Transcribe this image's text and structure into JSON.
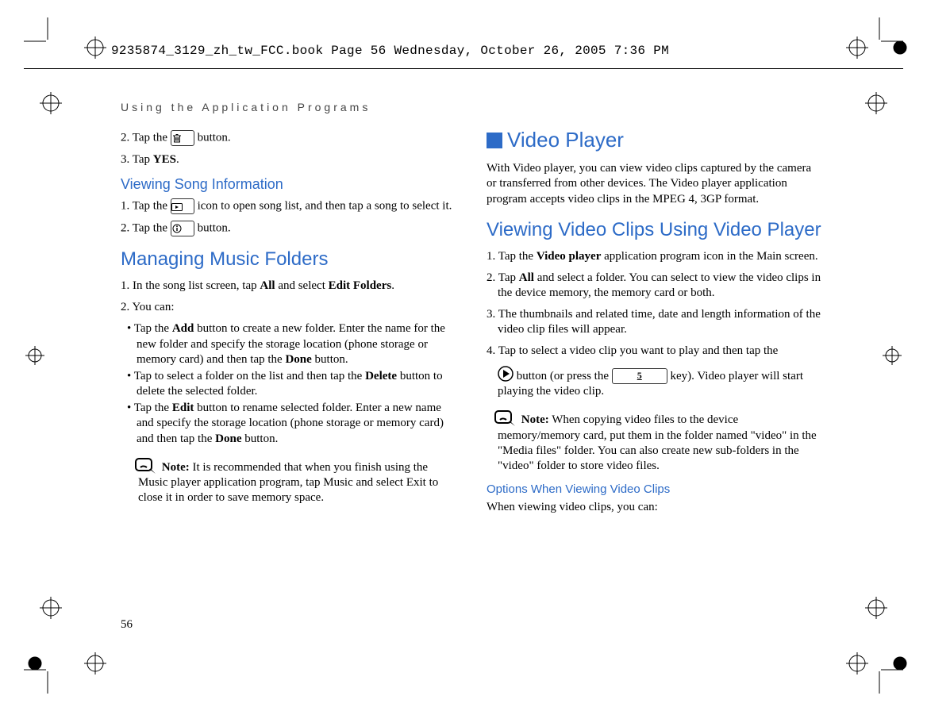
{
  "header": {
    "framemaker_line": "9235874_3129_zh_tw_FCC.book  Page 56  Wednesday, October 26, 2005  7:36 PM"
  },
  "running_head": "Using the Application Programs",
  "page_number": "56",
  "left": {
    "step2_a": "2. Tap the ",
    "step2_b": " button.",
    "step3": "3. Tap ",
    "step3_bold": "YES",
    "step3_end": ".",
    "h_view_song": "Viewing Song Information",
    "vs_step1_a": "1. Tap the ",
    "vs_step1_b": " icon to open song list, and then tap a song to select it.",
    "vs_step2_a": "2. Tap the ",
    "vs_step2_b": " button.",
    "h_manage": "Managing Music Folders",
    "mf_step1_a": "1. In the song list screen, tap ",
    "mf_step1_all": "All",
    "mf_step1_b": " and select ",
    "mf_step1_ef": "Edit Folders",
    "mf_step1_end": ".",
    "mf_step2": "2. You can:",
    "mf_b1_a": "• Tap the ",
    "mf_b1_add": "Add",
    "mf_b1_b": " button to create a new folder. Enter the name for the new folder and specify the storage location (phone storage or memory card) and then tap the ",
    "mf_b1_done": "Done",
    "mf_b1_end": " button.",
    "mf_b2_a": "•  Tap to select a folder on the list and then tap the ",
    "mf_b2_del": "Delete",
    "mf_b2_b": " button to delete the selected folder.",
    "mf_b3_a": "• Tap the ",
    "mf_b3_edit": "Edit",
    "mf_b3_b": " button to rename selected folder. Enter a new name and specify the storage location (phone storage or memory card) and then tap the ",
    "mf_b3_done": "Done",
    "mf_b3_end": " button.",
    "note_label": "Note:",
    "note_body": " It is recommended that when you finish using the Music player application program, tap Music and select Exit to close it in order to save memory space."
  },
  "right": {
    "h_video": "Video Player",
    "intro": "With Video player, you can view video clips captured by the camera or transferred from other devices. The Video player application program accepts video clips in the MPEG 4, 3GP format.",
    "h_viewclips": "Viewing Video Clips Using Video Player",
    "vc1_a": "1. Tap the ",
    "vc1_vp": "Video player",
    "vc1_b": " application program icon in the Main screen.",
    "vc2_a": "2. Tap ",
    "vc2_all": "All",
    "vc2_b": " and select a folder. You can select to view the video clips in the device memory, the memory card or both.",
    "vc3": "3. The thumbnails and related time, date and length information of the video clip files will appear.",
    "vc4_a": "4. Tap to select a video clip you want to play and then tap the ",
    "vc4_b": " button (or press the ",
    "vc4_key": "5",
    "vc4_c": " key). Video player will start playing the video clip.",
    "note2_label": "Note:",
    "note2_body": " When copying video files to the device memory/memory card, put them in the folder named \"video\" in the \"Media files\" folder. You can also create new sub-folders in the \"video\" folder to store video files.",
    "h_options": "Options When Viewing Video Clips",
    "opt_intro": "When viewing video clips, you can:"
  }
}
